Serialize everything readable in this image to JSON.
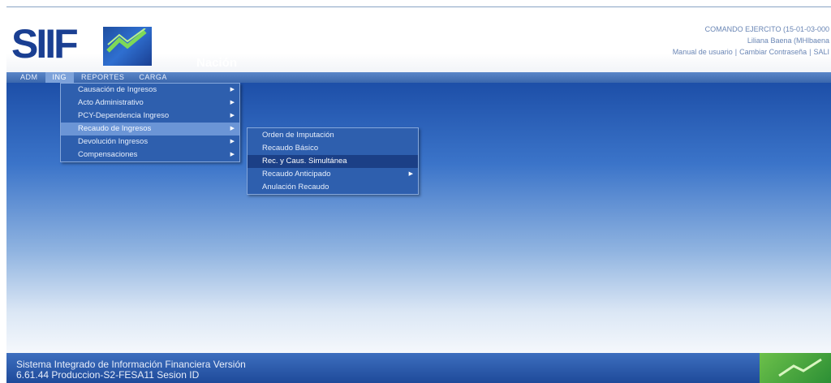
{
  "header": {
    "logo_text": "SIIF",
    "logo_sub": "Nación",
    "user_unit": "COMANDO EJERCITO (15-01-03-000",
    "user_name": "Liliana Baena (MHlbaena",
    "links": [
      "Manual de usuario",
      "Cambiar Contraseña",
      "SALI"
    ]
  },
  "menubar": {
    "tabs": [
      "ADM",
      "ING",
      "REPORTES",
      "CARGA"
    ],
    "active": "ING"
  },
  "ing_menu": {
    "items": [
      {
        "label": "Causación de Ingresos"
      },
      {
        "label": "Acto Administrativo"
      },
      {
        "label": "PCY-Dependencia Ingreso"
      },
      {
        "label": "Recaudo de Ingresos"
      },
      {
        "label": "Devolución Ingresos"
      },
      {
        "label": "Compensaciones"
      }
    ],
    "highlighted": "Recaudo de Ingresos"
  },
  "recaudo_menu": {
    "items": [
      {
        "label": "Orden de Imputación"
      },
      {
        "label": "Recaudo Básico"
      },
      {
        "label": "Rec. y Caus. Simultánea"
      },
      {
        "label": "Recaudo Anticipado"
      },
      {
        "label": "Anulación Recaudo"
      }
    ],
    "selected": "Rec. y Caus. Simultánea"
  },
  "footer": {
    "line1": "Sistema Integrado de Información Financiera Versión",
    "line2": "6.61.44 Produccion-S2-FESA11 Sesion ID"
  },
  "colors": {
    "brand_blue": "#1a3f92",
    "menu_bg": "#2e5fae",
    "menu_highlight": "#6b95d6",
    "menu_selected": "#1b3f86",
    "accent_green": "#4caf3c"
  }
}
